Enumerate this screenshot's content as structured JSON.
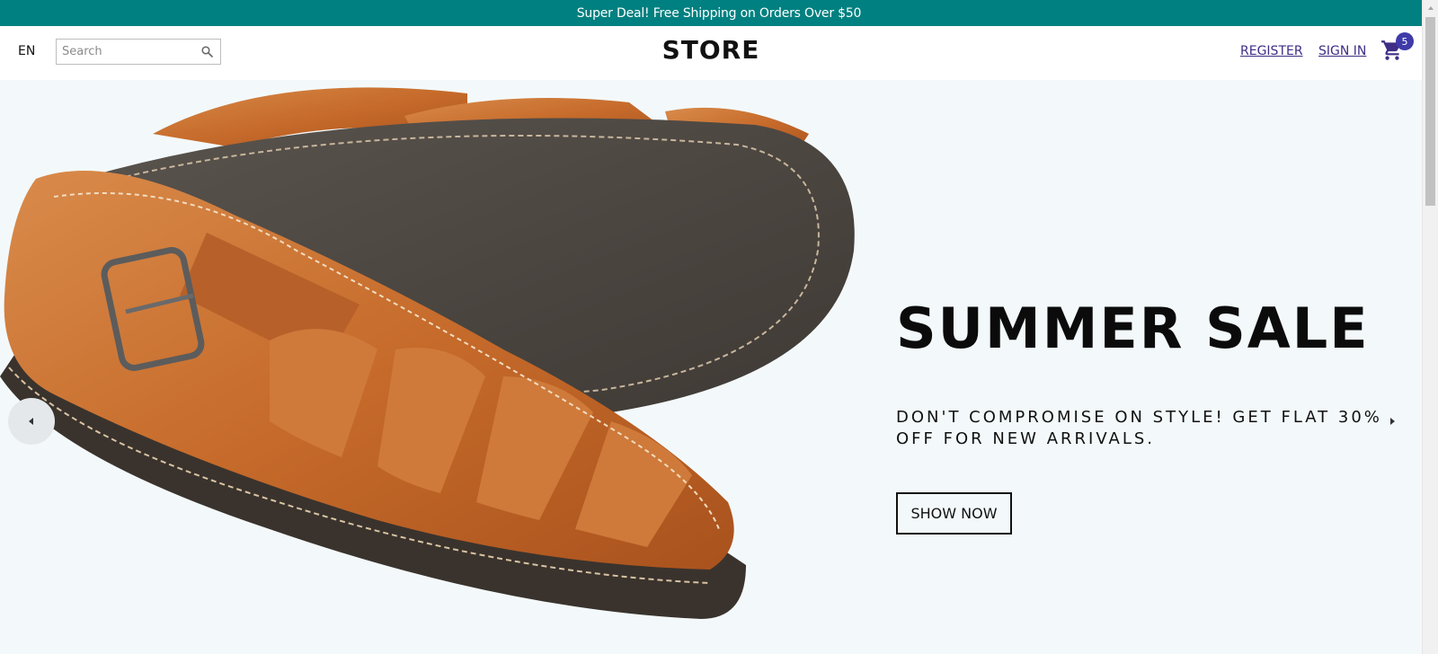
{
  "announcement": "Super Deal! Free Shipping on Orders Over $50",
  "header": {
    "language": "EN",
    "search": {
      "placeholder": "Search",
      "value": ""
    },
    "logo": "STORE",
    "links": {
      "register": "REGISTER",
      "sign_in": "SIGN IN"
    },
    "cart_count": "5"
  },
  "hero": {
    "title": "SUMMER SALE",
    "description": "DON'T COMPROMISE ON STYLE! GET FLAT 30% OFF FOR NEW ARRIVALS.",
    "button": "SHOW NOW",
    "image": "leather-sandal",
    "background": "#f3f9fb"
  },
  "colors": {
    "announcement_bg": "#008080",
    "link": "#3f2d86",
    "badge": "#3e3aa8",
    "leather": "#c66b2b",
    "sole": "#4a4540"
  },
  "icons": {
    "search": "search-icon",
    "cart": "cart-icon",
    "prev": "arrow-left-icon",
    "next": "arrow-right-icon"
  }
}
